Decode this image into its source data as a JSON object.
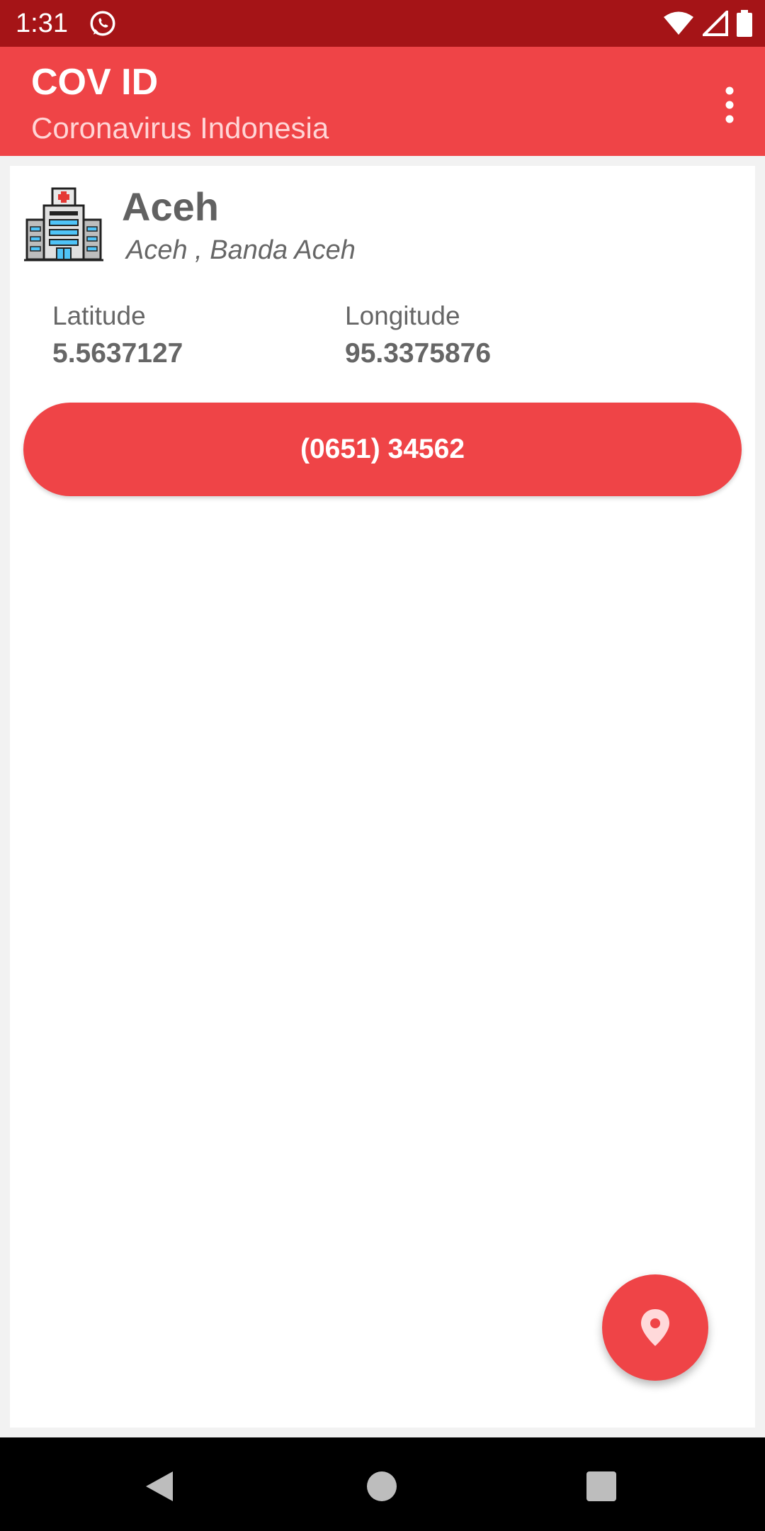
{
  "status_bar": {
    "time": "1:31",
    "icons": [
      "whatsapp-icon",
      "wifi-icon",
      "cell-signal-icon",
      "battery-icon"
    ]
  },
  "app_bar": {
    "title": "COV ID",
    "subtitle": "Coronavirus Indonesia",
    "menu_icon": "more-vert-icon"
  },
  "location": {
    "icon": "hospital-icon",
    "name": "Aceh",
    "address": "Aceh , Banda Aceh",
    "latitude_label": "Latitude",
    "latitude_value": "5.5637127",
    "longitude_label": "Longitude",
    "longitude_value": "95.3375876",
    "phone": "(0651) 34562"
  },
  "fab": {
    "icon": "map-pin-icon"
  },
  "nav_bar": {
    "icons": [
      "back-icon",
      "home-icon",
      "recents-icon"
    ]
  },
  "colors": {
    "status_bar": "#a51417",
    "accent": "#ef4447",
    "subtitle": "#ffd5d6"
  }
}
